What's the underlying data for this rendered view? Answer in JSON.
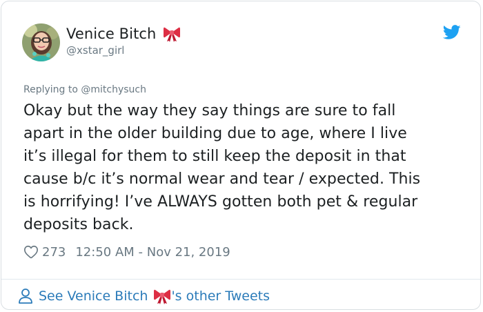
{
  "author": {
    "display_name": "Venice Bitch",
    "handle": "@xstar_girl",
    "name_emoji_icon": "ribbon-bow-icon"
  },
  "reply": {
    "prefix": "Replying to ",
    "mention": "@mitchysuch"
  },
  "tweet": {
    "text": "Okay but the way they say things are sure to fall\napart in the older building due to age, where I live\nit’s illegal for them to still keep the deposit in that\ncause b/c it’s normal wear and tear / expected. This\nis horrifying! I’ve ALWAYS gotten both pet & regular\ndeposits back."
  },
  "meta": {
    "likes": "273",
    "timestamp": "12:50 AM - Nov 21, 2019"
  },
  "footer": {
    "prefix": "See Venice Bitch",
    "suffix": "'s other Tweets"
  },
  "colors": {
    "text": "#1c2022",
    "muted": "#697882",
    "link": "#2b7bb9",
    "twitter_blue": "#1da1f2",
    "ribbon_red": "#e0245e",
    "border": "#d9dee2"
  }
}
